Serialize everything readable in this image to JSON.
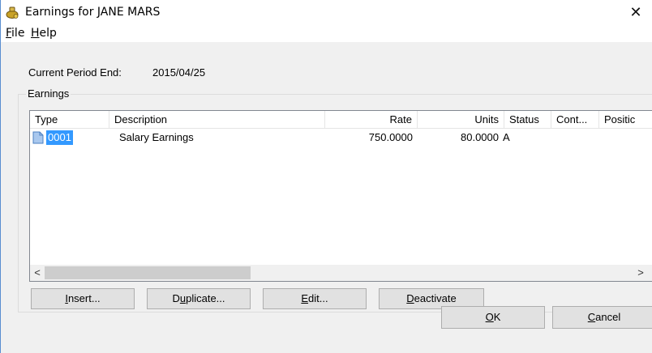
{
  "window": {
    "title": "Earnings for JANE MARS",
    "close_glyph": "✕",
    "icon": "coin-bag-icon"
  },
  "menu": [
    {
      "label": "File"
    },
    {
      "label": "Help"
    }
  ],
  "period": {
    "label": "Current Period End:",
    "value": "2015/04/25"
  },
  "earnings_group": {
    "label": "Earnings"
  },
  "list": {
    "columns": [
      "Type",
      "Description",
      "Rate",
      "Units",
      "Status",
      "Cont...",
      "Positic"
    ],
    "rows": [
      {
        "type": "0001",
        "description": "Salary Earnings",
        "rate": "750.0000",
        "units": "80.0000",
        "status": "A",
        "cont": "",
        "position": ""
      }
    ],
    "scroll_left": "<",
    "scroll_right": ">"
  },
  "buttons": {
    "insert_pre": "",
    "insert_u": "I",
    "insert_post": "nsert...",
    "duplicate_pre": "D",
    "duplicate_u": "u",
    "duplicate_post": "plicate...",
    "edit_pre": "",
    "edit_u": "E",
    "edit_post": "dit...",
    "deactivate_pre": "",
    "deactivate_u": "D",
    "deactivate_post": "eactivate",
    "ok_pre": "",
    "ok_u": "O",
    "ok_post": "K",
    "cancel_pre": "",
    "cancel_u": "C",
    "cancel_post": "ancel"
  },
  "colors": {
    "selection": "#3399ff",
    "window_bg": "#f0f0f0"
  }
}
